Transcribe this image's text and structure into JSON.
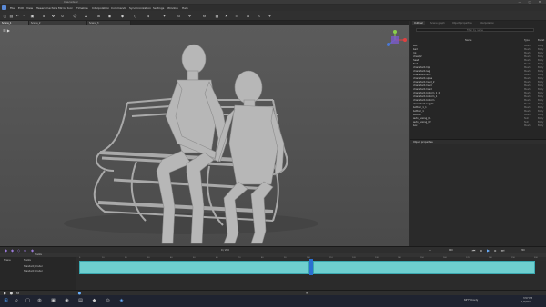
{
  "app": {
    "title": "Cascadeur"
  },
  "menu": [
    "File",
    "Edit",
    "View",
    "Tween machine",
    "Mirror tool",
    "Timeline",
    "Interpolation",
    "Commands",
    "Synchronization",
    "Settings",
    "Window",
    "Help"
  ],
  "doc_tabs": [
    {
      "label": "Scene_1"
    },
    {
      "label": "Scene_2"
    },
    {
      "label": "Scene_3"
    }
  ],
  "outliner": {
    "tabs": [
      "Outliner",
      "Scene graph",
      "Object properties",
      "Interpolation"
    ],
    "filter_placeholder": "Filter by name",
    "columns": {
      "name": "Name",
      "type": "Type",
      "bullet": "Bullet"
    },
    "rows": [
      {
        "name": "box",
        "type": "Mesh",
        "bullet": "Body"
      },
      {
        "name": "bed",
        "type": "Mesh",
        "bullet": "Body"
      },
      {
        "name": "rig",
        "type": "Mesh",
        "bullet": "Body"
      },
      {
        "name": "chest_2",
        "type": "Mesh",
        "bullet": "Body"
      },
      {
        "name": "head",
        "type": "Mesh",
        "bullet": "Body"
      },
      {
        "name": "feet",
        "type": "Mesh",
        "bullet": "Body"
      },
      {
        "name": "character1:hip",
        "type": "Mesh",
        "bullet": "Body"
      },
      {
        "name": "character1:leg",
        "type": "Mesh",
        "bullet": "Body"
      },
      {
        "name": "character1:arm",
        "type": "Mesh",
        "bullet": "Body"
      },
      {
        "name": "character1:spine",
        "type": "Mesh",
        "bullet": "Body"
      },
      {
        "name": "character1:head_2",
        "type": "Mesh",
        "bullet": "Body"
      },
      {
        "name": "character1:head",
        "type": "Mesh",
        "bullet": "Body"
      },
      {
        "name": "character1:hand",
        "type": "Mesh",
        "bullet": "Body"
      },
      {
        "name": "character1:bottom_1_2",
        "type": "Mesh",
        "bullet": "Body"
      },
      {
        "name": "character1:bottom_1",
        "type": "Mesh",
        "bullet": "Body"
      },
      {
        "name": "character1:bottom",
        "type": "Mesh",
        "bullet": "Body"
      },
      {
        "name": "character1:leg_01",
        "type": "Mesh",
        "bullet": "Body"
      },
      {
        "name": "bottom_1_1",
        "type": "Mesh",
        "bullet": "Body"
      },
      {
        "name": "bottom_1",
        "type": "Mesh",
        "bullet": "Body"
      },
      {
        "name": "bottom",
        "type": "Mesh",
        "bullet": "Body"
      },
      {
        "name": "auto_posing_01",
        "type": "Null",
        "bullet": "Body"
      },
      {
        "name": "auto_posing_02",
        "type": "Null",
        "bullet": "Body"
      },
      {
        "name": "box",
        "type": "Mesh",
        "bullet": "Body"
      }
    ],
    "object_properties_label": "Object properties"
  },
  "timeline": {
    "tracks_label": "Tracks",
    "rows": [
      {
        "label": "Scene"
      },
      {
        "label": "Tracks"
      },
      {
        "label": "Standard_model"
      },
      {
        "label": "Standard_model"
      }
    ],
    "ticks": [
      "0",
      "10",
      "20",
      "30",
      "40",
      "50",
      "60",
      "70",
      "80",
      "90",
      "100",
      "110",
      "120",
      "130",
      "140",
      "150",
      "160",
      "170",
      "180",
      "190",
      "200"
    ],
    "frame_display": "0 / 200",
    "current_frame": "100",
    "end_frame": "200"
  },
  "taskbar": {
    "weather": "66°F Cloudy",
    "time": "3:57 PM",
    "date": "1/2/2024"
  },
  "colors": {
    "clip": "#6ecfcf",
    "playhead": "#2a6fd1",
    "viewport_top": "#5b5b5b",
    "viewport_bottom": "#4a4a4a"
  }
}
